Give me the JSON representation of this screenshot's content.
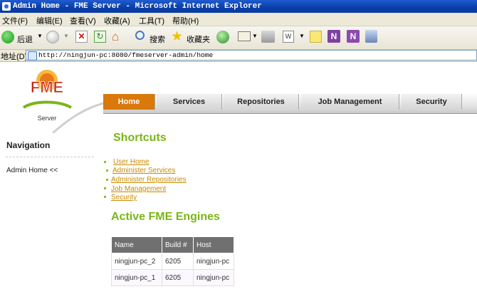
{
  "window": {
    "title": "Admin Home - FME Server - Microsoft Internet Explorer"
  },
  "menu": [
    "文件(F)",
    "编辑(E)",
    "查看(V)",
    "收藏(A)",
    "工具(T)",
    "帮助(H)"
  ],
  "toolbar": {
    "back_label": "后退",
    "search_label": "搜索",
    "favorites_label": "收藏夹",
    "word_label": "W"
  },
  "address": {
    "label": "地址(D)",
    "url": "http://ningjun-pc:8080/fmeserver-admin/home"
  },
  "logo": {
    "text": "FME",
    "subtext": "Server"
  },
  "tabs": [
    {
      "label": "Home",
      "active": true
    },
    {
      "label": "Services",
      "active": false
    },
    {
      "label": "Repositories",
      "active": false
    },
    {
      "label": "Job Management",
      "active": false
    },
    {
      "label": "Security",
      "active": false
    }
  ],
  "navigation": {
    "title": "Navigation",
    "item": "Admin Home <<"
  },
  "shortcuts": {
    "title": "Shortcuts",
    "links": [
      "User Home",
      "Administer Services",
      "Administer Repositories",
      "Job Management",
      "Security"
    ]
  },
  "engines": {
    "title": "Active FME Engines",
    "columns": [
      "Name",
      "Build #",
      "Host"
    ],
    "rows": [
      [
        "ningjun-pc_2",
        "6205",
        "ningjun-pc"
      ],
      [
        "ningjun-pc_1",
        "6205",
        "ningjun-pc"
      ]
    ]
  },
  "colors": {
    "accent_orange": "#d9780b",
    "heading_green": "#7ab619",
    "link_gold": "#c78b00",
    "title_blue": "#0a3ea8"
  }
}
